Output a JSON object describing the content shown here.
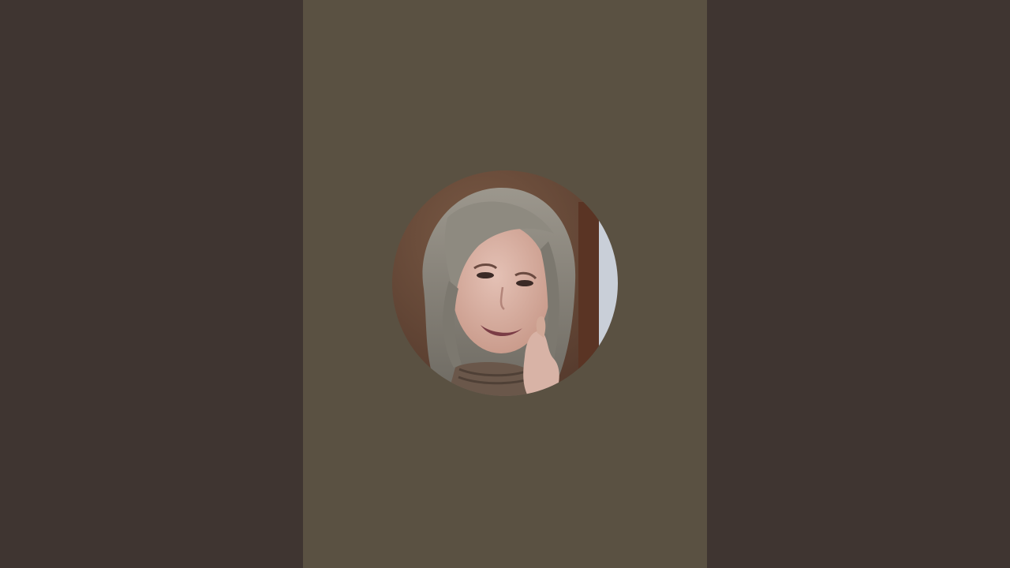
{
  "screen": {
    "type": "vertical video placeholder",
    "colors": {
      "pillarbox": "#3f3531",
      "stage": "#5a5142"
    }
  },
  "avatar": {
    "kind": "profile-photo",
    "shape": "circle",
    "colors": {
      "background": "#6b4a35",
      "door": "#5a3424",
      "light": "#c9cfd8",
      "hair": "#8e8a80",
      "skin": "#d9b2a5",
      "sweater": "#6a574a",
      "lips": "#7a3c45"
    }
  }
}
